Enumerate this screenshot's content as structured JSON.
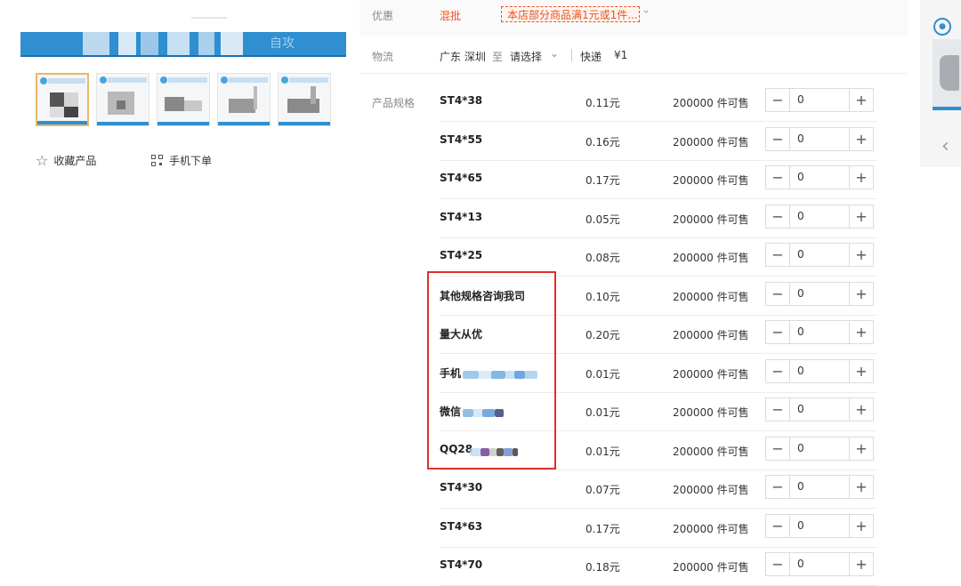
{
  "gallery": {
    "main_image_text": "自攻",
    "thumbnail_count": 5
  },
  "actions": {
    "favorite_label": "收藏产品",
    "mobile_order_label": "手机下单"
  },
  "promotion": {
    "label": "优惠",
    "tag": "混批",
    "text": "本店部分商品满1元或1件..."
  },
  "logistics": {
    "label": "物流",
    "from": "广东 深圳",
    "to_label": "至",
    "destination": "请选择",
    "method": "快递",
    "price": "¥1"
  },
  "specs": {
    "label": "产品规格",
    "rows": [
      {
        "name": "ST4*38",
        "price": "0.11元",
        "stock": "200000 件可售",
        "qty": "0"
      },
      {
        "name": "ST4*55",
        "price": "0.16元",
        "stock": "200000 件可售",
        "qty": "0"
      },
      {
        "name": "ST4*65",
        "price": "0.17元",
        "stock": "200000 件可售",
        "qty": "0"
      },
      {
        "name": "ST4*13",
        "price": "0.05元",
        "stock": "200000 件可售",
        "qty": "0"
      },
      {
        "name": "ST4*25",
        "price": "0.08元",
        "stock": "200000 件可售",
        "qty": "0"
      },
      {
        "name": "其他规格咨询我司",
        "price": "0.10元",
        "stock": "200000 件可售",
        "qty": "0"
      },
      {
        "name": "量大从优",
        "price": "0.20元",
        "stock": "200000 件可售",
        "qty": "0"
      },
      {
        "name": "手机",
        "price": "0.01元",
        "stock": "200000 件可售",
        "qty": "0"
      },
      {
        "name": "微信",
        "price": "0.01元",
        "stock": "200000 件可售",
        "qty": "0"
      },
      {
        "name": "QQ28",
        "price": "0.01元",
        "stock": "200000 件可售",
        "qty": "0"
      },
      {
        "name": "ST4*30",
        "price": "0.07元",
        "stock": "200000 件可售",
        "qty": "0"
      },
      {
        "name": "ST4*63",
        "price": "0.17元",
        "stock": "200000 件可售",
        "qty": "0"
      },
      {
        "name": "ST4*70",
        "price": "0.18元",
        "stock": "200000 件可售",
        "qty": "0"
      }
    ],
    "minus_symbol": "−",
    "plus_symbol": "+"
  },
  "colors": {
    "brand_blue": "#2f8fd0",
    "promo_orange": "#e8531f",
    "highlight_red": "#e0302a",
    "thumb_active_border": "#e9b865"
  }
}
